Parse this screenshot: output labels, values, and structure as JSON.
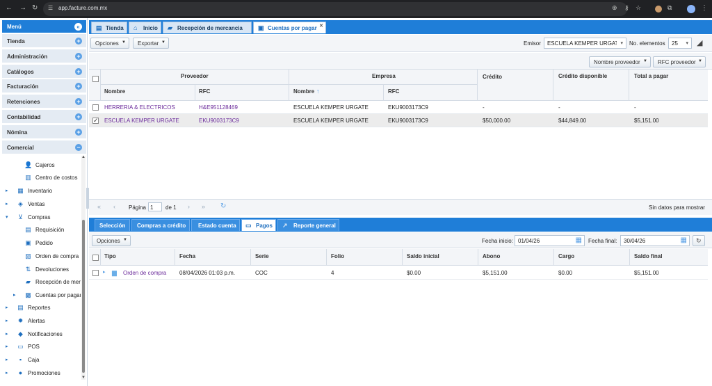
{
  "browser": {
    "url": "app.facture.com.mx"
  },
  "sidebar": {
    "title": "Menú",
    "sections": [
      {
        "label": "Tienda",
        "state": "+"
      },
      {
        "label": "Administración",
        "state": "+"
      },
      {
        "label": "Catálogos",
        "state": "+"
      },
      {
        "label": "Facturación",
        "state": "+"
      },
      {
        "label": "Retenciones",
        "state": "+"
      },
      {
        "label": "Contabilidad",
        "state": "+"
      },
      {
        "label": "Nómina",
        "state": "+"
      },
      {
        "label": "Comercial",
        "state": "−"
      }
    ],
    "tree": [
      {
        "label": "Cajeros",
        "level": 2,
        "icon": "user-icon"
      },
      {
        "label": "Centro de costos",
        "level": 2,
        "icon": "building-icon"
      },
      {
        "label": "Inventario",
        "level": 1,
        "icon": "boxes-icon"
      },
      {
        "label": "Ventas",
        "level": 1,
        "icon": "tag-icon"
      },
      {
        "label": "Compras",
        "level": 1,
        "icon": "cart-icon"
      },
      {
        "label": "Requisición",
        "level": 2,
        "icon": "doc-icon"
      },
      {
        "label": "Pedido",
        "level": 2,
        "icon": "person-box-icon"
      },
      {
        "label": "Orden de compra",
        "level": 2,
        "icon": "order-icon"
      },
      {
        "label": "Devoluciones",
        "level": 2,
        "icon": "return-icon"
      },
      {
        "label": "Recepción de mercancía",
        "level": 2,
        "icon": "truck-icon"
      },
      {
        "label": "Cuentas por pagar",
        "level": 2,
        "icon": "accounts-icon"
      },
      {
        "label": "Reportes",
        "level": 1,
        "icon": "report-icon"
      },
      {
        "label": "Alertas",
        "level": 1,
        "icon": "alert-icon"
      },
      {
        "label": "Notificaciones",
        "level": 1,
        "icon": "bell-icon"
      },
      {
        "label": "POS",
        "level": 1,
        "icon": "pos-icon"
      },
      {
        "label": "Caja",
        "level": 1,
        "icon": "cash-icon"
      },
      {
        "label": "Promociones",
        "level": 1,
        "icon": "promo-icon"
      }
    ]
  },
  "tabs": [
    {
      "label": "Tienda"
    },
    {
      "label": "Inicio"
    },
    {
      "label": "Recepción de mercancia"
    },
    {
      "label": "Cuentas por pagar",
      "active": true
    }
  ],
  "toolbar": {
    "opciones": "Opciones",
    "exportar": "Exportar",
    "emisor_label": "Emisor",
    "emisor_value": "ESCUELA KEMPER URGATE",
    "elementos_label": "No. elementos",
    "elementos_value": "25",
    "filter_proveedor": "Nombre proveedor",
    "filter_rfc": "RFC proveedor"
  },
  "grid": {
    "group_proveedor": "Proveedor",
    "group_empresa": "Empresa",
    "col_nombre": "Nombre",
    "col_rfc": "RFC",
    "col_emp_nombre": "Nombre",
    "col_emp_rfc": "RFC",
    "col_credito": "Crédito",
    "col_credito_disp": "Crédito disponible",
    "col_total": "Total a pagar",
    "rows": [
      {
        "nombre": "HERRERIA & ELECTRICOS",
        "rfc": "H&E951128469",
        "emp_nombre": "ESCUELA KEMPER URGATE",
        "emp_rfc": "EKU9003173C9",
        "credito": "-",
        "disp": "-",
        "total": "-",
        "checked": false
      },
      {
        "nombre": "ESCUELA KEMPER URGATE",
        "rfc": "EKU9003173C9",
        "emp_nombre": "ESCUELA KEMPER URGATE",
        "emp_rfc": "EKU9003173C9",
        "credito": "$50,000.00",
        "disp": "$44,849.00",
        "total": "$5,151.00",
        "checked": true
      }
    ]
  },
  "pager": {
    "pagina": "Página",
    "page": "1",
    "de": "de 1",
    "status": "Sin datos para mostrar"
  },
  "bottom_tabs": [
    {
      "label": "Selección"
    },
    {
      "label": "Compras a crédito"
    },
    {
      "label": "Estado cuenta"
    },
    {
      "label": "Pagos",
      "active": true
    },
    {
      "label": "Reporte general"
    }
  ],
  "bottom_toolbar": {
    "opciones": "Opciones",
    "fecha_inicio_label": "Fecha inicio:",
    "fecha_inicio": "01/04/26",
    "fecha_final_label": "Fecha final:",
    "fecha_final": "30/04/26"
  },
  "pagos": {
    "cols": [
      "Tipo",
      "Fecha",
      "Serie",
      "Folio",
      "Saldo inicial",
      "Abono",
      "Cargo",
      "Saldo final"
    ],
    "rows": [
      {
        "tipo": "Orden de compra",
        "fecha": "08/04/2026 01:03 p.m.",
        "serie": "COC",
        "folio": "4",
        "saldo_inicial": "$0.00",
        "abono": "$5,151.00",
        "cargo": "$0.00",
        "saldo_final": "$5,151.00"
      }
    ]
  }
}
